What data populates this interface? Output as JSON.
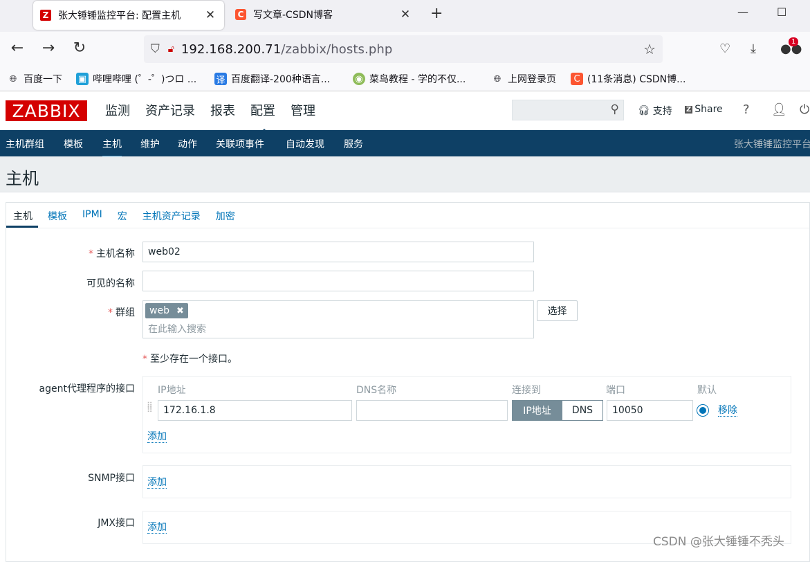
{
  "browser": {
    "tabs": [
      {
        "title": "张大锤锤监控平台: 配置主机",
        "icon": "Z"
      },
      {
        "title": "写文章-CSDN博客",
        "icon": "C"
      }
    ],
    "url_host": "192.168.200.71",
    "url_path": "/zabbix/hosts.php",
    "badge_count": "1",
    "bookmarks": [
      {
        "label": "百度一下",
        "icon": "globe-icon"
      },
      {
        "label": "哔哩哔哩 (゜-゜)つロ ...",
        "icon": "bilibili-icon"
      },
      {
        "label": "百度翻译-200种语言...",
        "icon": "translate-icon"
      },
      {
        "label": "菜鸟教程 - 学的不仅...",
        "icon": "runoob-icon"
      },
      {
        "label": "上网登录页",
        "icon": "globe-icon"
      },
      {
        "label": "(11条消息) CSDN博...",
        "icon": "csdn-icon"
      }
    ]
  },
  "header": {
    "logo": "ZABBIX",
    "menu": [
      "监测",
      "资产记录",
      "报表",
      "配置",
      "管理"
    ],
    "support": "支持",
    "share": "Share",
    "help": "?"
  },
  "subnav": {
    "items": [
      "主机群组",
      "模板",
      "主机",
      "维护",
      "动作",
      "关联项事件",
      "自动发现",
      "服务"
    ],
    "right_text": "张大锤锤监控平台"
  },
  "page": {
    "title": "主机",
    "tabs": [
      "主机",
      "模板",
      "IPMI",
      "宏",
      "主机资产记录",
      "加密"
    ]
  },
  "form": {
    "host_name_label": "主机名称",
    "host_name_value": "web02",
    "visible_name_label": "可见的名称",
    "visible_name_value": "",
    "groups_label": "群组",
    "group_chip": "web",
    "group_placeholder": "在此输入搜索",
    "select_button": "选择",
    "required_mark": "*",
    "notice": "至少存在一个接口。",
    "agent_label": "agent代理程序的接口",
    "columns": {
      "ip": "IP地址",
      "dns": "DNS名称",
      "connect": "连接到",
      "port": "端口",
      "default": "默认"
    },
    "agent_row": {
      "ip": "172.16.1.8",
      "dns": "",
      "conn_ip": "IP地址",
      "conn_dns": "DNS",
      "port": "10050",
      "remove": "移除"
    },
    "add": "添加",
    "snmp_label": "SNMP接口",
    "jmx_label": "JMX接口"
  },
  "watermark": "CSDN @张大锤锤不秃头"
}
